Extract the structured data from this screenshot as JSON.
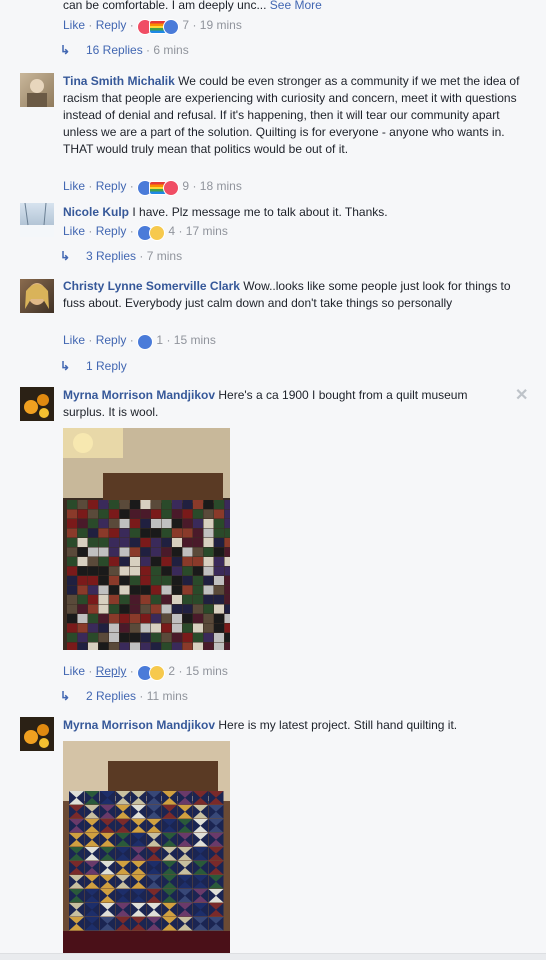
{
  "comments": [
    {
      "text": "can be comfortable. I am deeply unc...",
      "see_more": "See More",
      "actions": {
        "like": "Like",
        "reply": "Reply",
        "sep": "·"
      },
      "reaction_count": "7",
      "time": "19 mins",
      "replies": "16 Replies",
      "replies_time": "6 mins"
    },
    {
      "name": "Tina Smith Michalik",
      "text": "We could be even stronger as a community if we met the idea of racism that people are experiencing with curiosity and concern, meet it with questions instead of denial and refusal. If it's happening, then it will tear our community apart unless we are a part of the solution. Quilting is for everyone - anyone who wants in. THAT would truly mean that politics would be out of it.",
      "actions": {
        "like": "Like",
        "reply": "Reply",
        "sep": "·"
      },
      "reaction_count": "9",
      "time": "18 mins"
    },
    {
      "name": "Nicole Kulp",
      "text": "I have. Plz message me to talk about it. Thanks.",
      "actions": {
        "like": "Like",
        "reply": "Reply",
        "sep": "·"
      },
      "reaction_count": "4",
      "time": "17 mins",
      "replies": "3 Replies",
      "replies_time": "7 mins"
    },
    {
      "name": "Christy Lynne Somerville Clark",
      "text": "Wow..looks like some people just look for things to fuss about. Everybody just calm down and don't take things so personally",
      "actions": {
        "like": "Like",
        "reply": "Reply",
        "sep": "·"
      },
      "reaction_count": "1",
      "time": "15 mins",
      "replies": "1 Reply"
    },
    {
      "name": "Myrna Morrison Mandjikov",
      "text": "Here's a ca 1900 I bought from a quilt museum surplus. It is wool.",
      "actions": {
        "like": "Like",
        "reply": "Reply",
        "sep": "·"
      },
      "reaction_count": "2",
      "time": "15 mins",
      "replies": "2 Replies",
      "replies_time": "11 mins"
    },
    {
      "name": "Myrna Morrison Mandjikov",
      "text": "Here is my latest project. Still hand quilting it."
    }
  ],
  "icons": {
    "close": "close-icon",
    "reply_arrow": "reply-arrow-icon"
  },
  "colors": {
    "link": "#4267b2",
    "name": "#365899",
    "meta": "#90949c",
    "background": "#f6f7f9"
  }
}
